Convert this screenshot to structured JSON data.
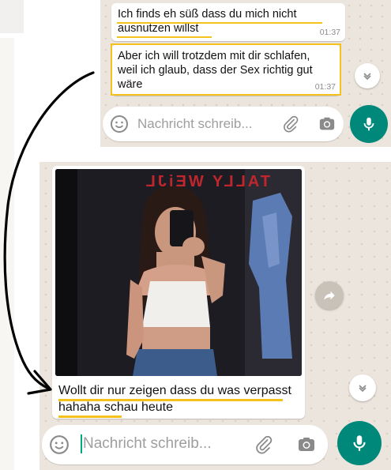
{
  "top_chat": {
    "messages": [
      {
        "text": "Ich finds eh süß dass du mich nicht ausnutzen willst",
        "time": "01:37"
      },
      {
        "text": "Aber ich will trotzdem mit dir schlafen, weil ich glaub, dass der Sex richtig gut wäre",
        "time": "01:37"
      }
    ],
    "input": {
      "placeholder": "Nachricht schreib..."
    }
  },
  "bottom_chat": {
    "image_message": {
      "photo_sign_text": "TALLY WEiJL",
      "caption": "Wollt dir nur zeigen dass du was verpasst hahaha schau heute"
    },
    "input": {
      "placeholder": "Nachricht schreib..."
    }
  },
  "icons": [
    "emoji-icon",
    "attachment-icon",
    "camera-icon",
    "microphone-icon",
    "chevron-down-icon",
    "forward-icon"
  ],
  "colors": {
    "accent": "#00897b",
    "highlight": "#f4c21a",
    "wallpaper": "#ece5dd"
  }
}
